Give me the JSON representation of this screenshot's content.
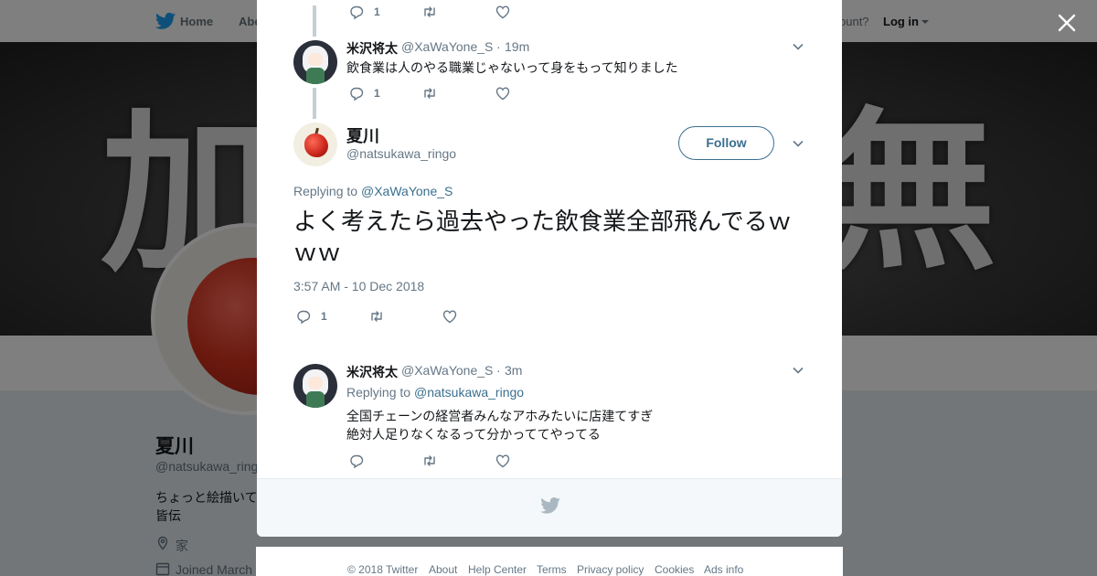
{
  "topnav": {
    "home_label": "Home",
    "about_label": "Abo",
    "account_prompt": "ccount?",
    "login_label": "Log in"
  },
  "banner": {
    "left_char": "加",
    "right_char": "無"
  },
  "profile": {
    "name": "夏川",
    "handle": "@natsukawa_ringo",
    "bio_line1": "ちょっと絵描いて",
    "bio_line2": "皆伝",
    "location": "家",
    "joined": "Joined March"
  },
  "thread": {
    "prev_tweet_top": {
      "reply_count": "1"
    },
    "prev_tweet": {
      "name": "米沢将太",
      "handle": "@XaWaYone_S",
      "dot": "·",
      "time": "19m",
      "text": "飲食業は人のやる職業じゃないって身をもって知りました",
      "reply_count": "1"
    },
    "main_tweet": {
      "name": "夏川",
      "handle": "@natsukawa_ringo",
      "follow_label": "Follow",
      "replying_prefix": "Replying to",
      "replying_to": "@XaWaYone_S",
      "text": "よく考えたら過去やった飲食業全部飛んでるｗｗｗ",
      "date": "3:57 AM - 10 Dec 2018",
      "reply_count": "1"
    },
    "reply_tweet": {
      "name": "米沢将太",
      "handle": "@XaWaYone_S",
      "dot": "·",
      "time": "3m",
      "replying_prefix": "Replying to",
      "replying_to": "@natsukawa_ringo",
      "text_line1": "全国チェーンの経営者みんなアホみたいに店建てすぎ",
      "text_line2": "絶対人足りなくなるって分かっててやってる"
    }
  },
  "footer": {
    "copyright": "© 2018 Twitter",
    "about": "About",
    "help": "Help Center",
    "terms": "Terms",
    "privacy": "Privacy policy",
    "cookies": "Cookies",
    "ads": "Ads info"
  },
  "colors": {
    "link": "#3b6f8f",
    "muted": "#657786",
    "thread_line": "#c4cfd6"
  },
  "icons": [
    "twitter-bird-icon",
    "close-icon",
    "reply-icon",
    "retweet-icon",
    "like-icon",
    "chevron-down-icon",
    "location-icon",
    "calendar-icon"
  ]
}
